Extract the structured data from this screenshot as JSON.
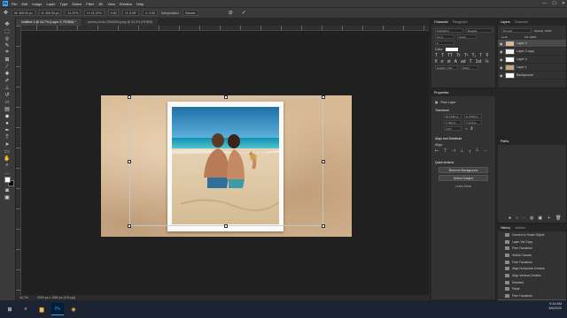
{
  "menu": [
    "File",
    "Edit",
    "Image",
    "Layer",
    "Type",
    "Select",
    "Filter",
    "3D",
    "View",
    "Window",
    "Help"
  ],
  "logo": "Ps",
  "window_controls": [
    "—",
    "☐",
    "✕"
  ],
  "options_bar": {
    "items": [
      "W: 300.00 px",
      "H: 300.00 px",
      "21.37%",
      "H: 21.37%",
      "0.00",
      "H: 0.00°",
      "V: 0.00",
      "Interpolation:",
      "Bicubic"
    ]
  },
  "doc_tabs": [
    "Untitled-1 @ 44.7% (Layer 3, RGB/8) *",
    "pexels-photo-2549659.jpeg @ 33.3% (RGB/8)"
  ],
  "status": {
    "zoom": "44.7%",
    "doc": "2000 px x 1080 px (100 ppi)"
  },
  "character_panel": {
    "tabs": [
      "Character",
      "Paragraph"
    ],
    "font": "Southland",
    "style": "Regular",
    "size": "12 pt",
    "leading": "(Auto)",
    "tracking": "0",
    "color_label": "Color:",
    "aa": "English: USA",
    "aa2": "Sharp"
  },
  "layers_panel": {
    "tabs": [
      "Layers",
      "Channels"
    ],
    "kind": "Normal",
    "opacity": "Opacity: 100%",
    "fill": "Fill: 100%",
    "lock": "Lock:",
    "layers": [
      {
        "name": "Layer 3",
        "selected": true
      },
      {
        "name": "Layer 2 copy",
        "selected": false
      },
      {
        "name": "Layer 2",
        "selected": false
      },
      {
        "name": "Layer 1",
        "selected": false
      },
      {
        "name": "Background",
        "selected": false
      }
    ]
  },
  "properties_panel": {
    "tab": "Properties",
    "type": "Pixel Layer",
    "transform_title": "Transform",
    "transform_fields": [
      "W 2706 px",
      "H 2705 px",
      "X 493 px",
      "Y 213 px",
      "0.00°"
    ],
    "align_title": "Align and Distribute",
    "align_label": "Align:",
    "quick_title": "Quick Actions",
    "quick_actions": [
      "Remove Background",
      "Select Subject",
      "Learn More"
    ]
  },
  "paths_panel": {
    "tab": "Paths"
  },
  "history_panel": {
    "tabs": [
      "History",
      "Actions"
    ],
    "items": [
      "Convert to Smart Object",
      "Layer Via Copy",
      "Free Transform",
      "Select Canvas",
      "Free Transform",
      "Align Horizontal Centers",
      "Align Vertical Centers",
      "Deselect",
      "Paste",
      "Free Transform",
      "Create Clipping Mask"
    ],
    "selected_index": 10
  },
  "taskbar": {
    "time": "9:16 AM",
    "date": "3/6/2020"
  },
  "colors": {
    "accent": "#31a8ff",
    "panel": "#323232",
    "paper": "#d8b995"
  }
}
